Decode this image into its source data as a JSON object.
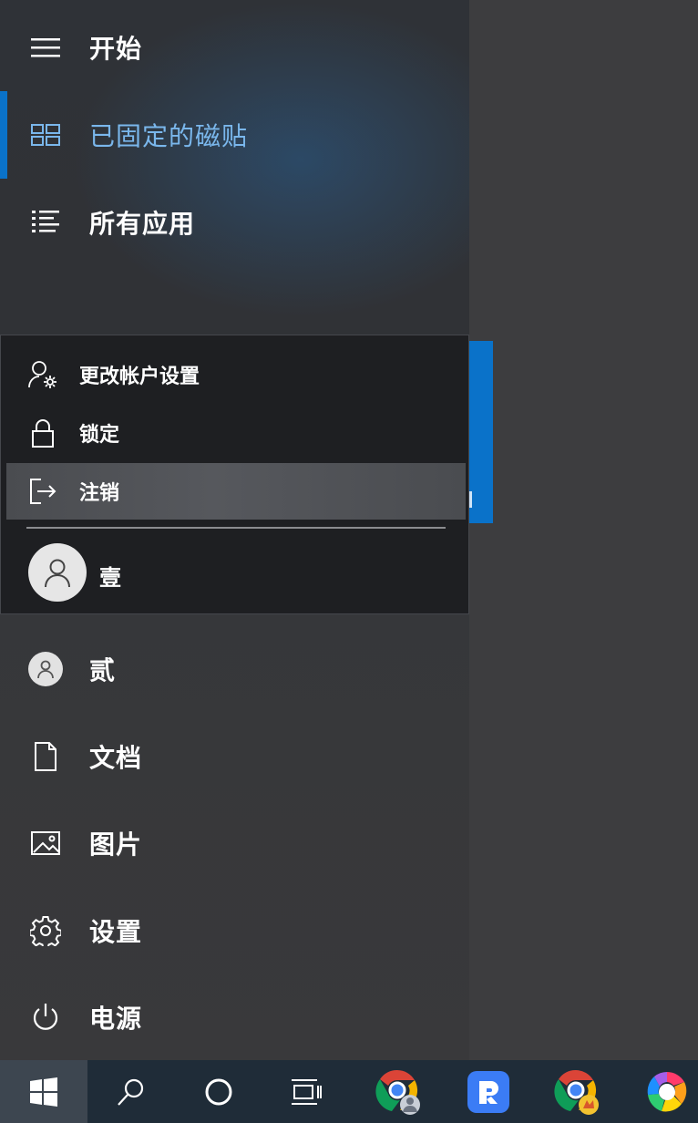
{
  "menu": {
    "header": {
      "title": "开始",
      "icon": "hamburger-icon"
    },
    "nav": [
      {
        "label": "已固定的磁贴",
        "icon": "tiles-icon",
        "active": true
      },
      {
        "label": "所有应用",
        "icon": "list-icon",
        "active": false
      }
    ],
    "account_popup": {
      "items": [
        {
          "label": "更改帐户设置",
          "icon": "account-settings-icon"
        },
        {
          "label": "锁定",
          "icon": "lock-icon"
        },
        {
          "label": "注销",
          "icon": "sign-out-icon",
          "highlighted": true
        }
      ],
      "user": {
        "name": "壹",
        "icon": "user-avatar-icon"
      }
    },
    "lower": [
      {
        "label": "贰",
        "icon": "user-avatar-icon"
      },
      {
        "label": "文档",
        "icon": "document-icon"
      },
      {
        "label": "图片",
        "icon": "picture-icon"
      },
      {
        "label": "设置",
        "icon": "gear-icon"
      },
      {
        "label": "电源",
        "icon": "power-icon"
      }
    ]
  },
  "taskbar": {
    "items": [
      "windows-start-icon",
      "search-icon",
      "cortana-icon",
      "task-view-icon",
      "chrome-user-icon",
      "app-r-icon",
      "chrome-profile-icon",
      "colorful-app-icon"
    ]
  },
  "colors": {
    "accent": "#0a72c9",
    "active_label": "#7ab7ec",
    "taskbar": "#1f2c38",
    "popup": "#1e1f22"
  }
}
